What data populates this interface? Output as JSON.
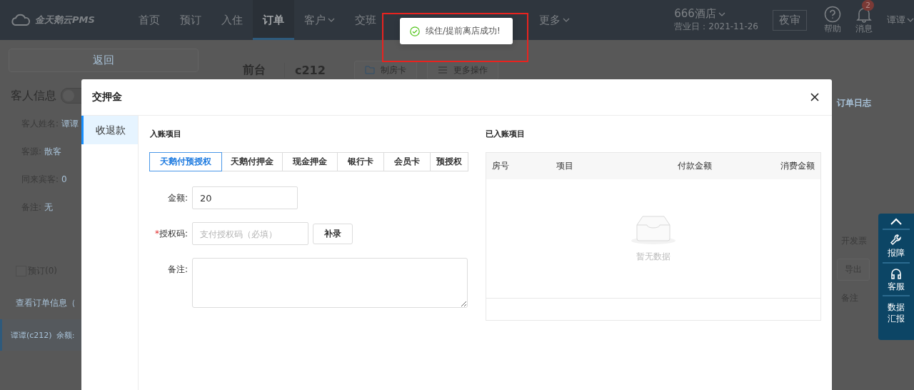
{
  "header": {
    "logo": "金天鹅云PMS",
    "nav": [
      {
        "label": "首页",
        "selected": false,
        "dropdown": false
      },
      {
        "label": "预订",
        "selected": false,
        "dropdown": false
      },
      {
        "label": "入住",
        "selected": false,
        "dropdown": false
      },
      {
        "label": "订单",
        "selected": true,
        "dropdown": false
      },
      {
        "label": "客户",
        "selected": false,
        "dropdown": true
      },
      {
        "label": "交班",
        "selected": false,
        "dropdown": false
      },
      {
        "label": "更多",
        "selected": false,
        "dropdown": true
      }
    ],
    "hotel": "666酒店",
    "business_day": "营业日：2021-11-26",
    "night_audit": "夜审",
    "help": "帮助",
    "messages": {
      "label": "消息",
      "badge": "2"
    },
    "user": "谭谭"
  },
  "sidebar": {
    "back": "返回",
    "guest_info": {
      "title": "客人信息",
      "toggle_on": false
    },
    "fields": [
      {
        "label": "客人姓名:",
        "value": "谭谭"
      },
      {
        "label": "客源:",
        "value": "散客"
      },
      {
        "label": "同来宾客:",
        "value": "0"
      },
      {
        "label": "备注:",
        "value": "无"
      }
    ],
    "reservation": {
      "label": "预订(0)",
      "checked": false
    },
    "order_link": "查看订单信息（",
    "room_row": {
      "label": "谭谭(c212)",
      "balance": "余额:",
      "selected": true
    }
  },
  "main": {
    "desk": "前台",
    "room": "c212",
    "actions": [
      "制房卡",
      "更多操作"
    ],
    "log_link": "订单日志",
    "invoice": "开发票",
    "export": "导出",
    "note": "备注"
  },
  "modal": {
    "title": "交押金",
    "menu": [
      {
        "label": "收退款",
        "selected": true
      }
    ],
    "entry_title": "入账项目",
    "payment_tabs": [
      {
        "label": "天鹅付预授权",
        "selected": true
      },
      {
        "label": "天鹅付押金",
        "selected": false
      },
      {
        "label": "现金押金",
        "selected": false
      },
      {
        "label": "银行卡",
        "selected": false
      },
      {
        "label": "会员卡",
        "selected": false
      },
      {
        "label": "预授权",
        "selected": false
      }
    ],
    "form": {
      "amount": {
        "label": "金额:",
        "value": "20"
      },
      "auth_code": {
        "required_mark": "*",
        "label": "授权码:",
        "placeholder": "支付授权码（必填）",
        "button": "补录"
      },
      "note": {
        "label": "备注:"
      }
    },
    "posted": {
      "title": "已入账项目",
      "columns": [
        "房号",
        "项目",
        "付款金额",
        "消费金额"
      ],
      "empty": "暂无数据"
    }
  },
  "toast": {
    "kind": "success",
    "message": "续住/提前离店成功!",
    "highlighted": true
  },
  "float_panel": {
    "items": [
      {
        "kind": "top"
      },
      {
        "kind": "repair",
        "label": "报障"
      },
      {
        "kind": "service",
        "label": "客服"
      },
      {
        "kind": "report",
        "label": "数据汇报"
      }
    ]
  }
}
